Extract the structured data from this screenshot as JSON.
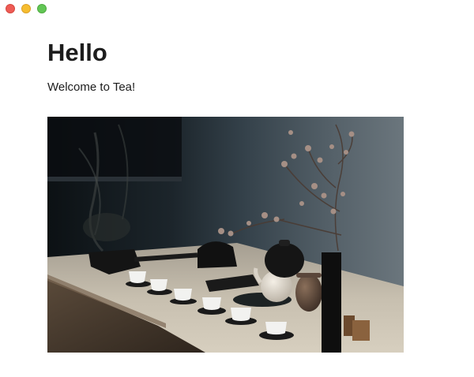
{
  "window": {
    "controls": [
      "close",
      "minimize",
      "zoom"
    ]
  },
  "page": {
    "heading": "Hello",
    "welcome": "Welcome to Tea!"
  },
  "photo": {
    "alt_icon": "tea-set-photo",
    "colors": {
      "wall": "#3e4a52",
      "table": "#cfc6b5",
      "cup": "#f2f2f0"
    }
  }
}
